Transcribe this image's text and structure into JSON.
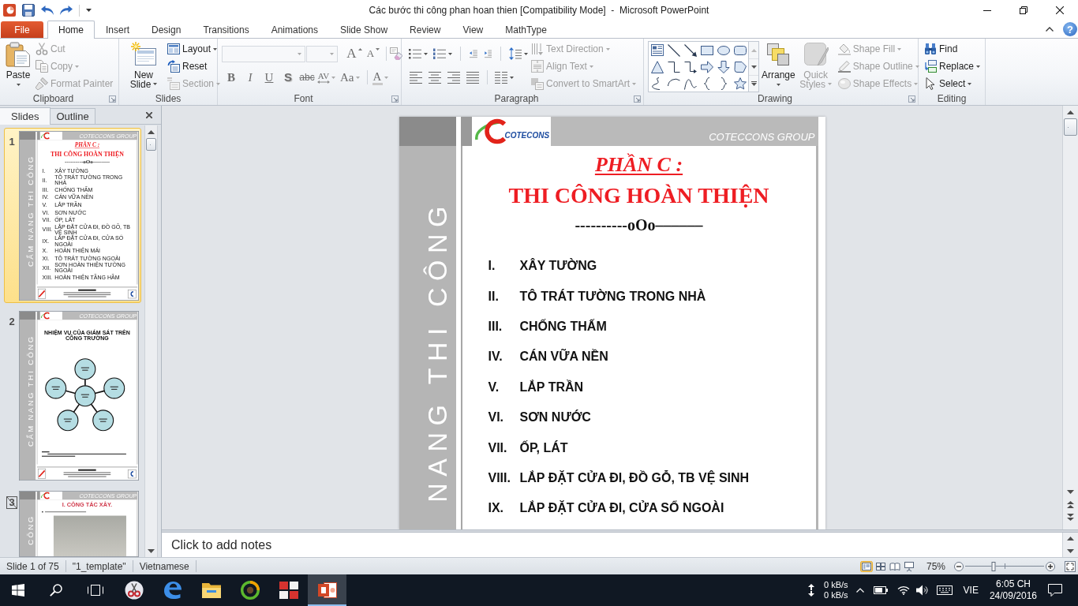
{
  "window": {
    "title": "Các bước thi công phan hoan thien [Compatibility Mode]  -  Microsoft PowerPoint"
  },
  "ribbon_tabs": [
    {
      "label": "File",
      "kind": "backstage",
      "selected": false
    },
    {
      "label": "Home",
      "kind": "tab",
      "selected": true
    },
    {
      "label": "Insert",
      "kind": "tab",
      "selected": false
    },
    {
      "label": "Design",
      "kind": "tab",
      "selected": false
    },
    {
      "label": "Transitions",
      "kind": "tab",
      "selected": false
    },
    {
      "label": "Animations",
      "kind": "tab",
      "selected": false
    },
    {
      "label": "Slide Show",
      "kind": "tab",
      "selected": false
    },
    {
      "label": "Review",
      "kind": "tab",
      "selected": false
    },
    {
      "label": "View",
      "kind": "tab",
      "selected": false
    },
    {
      "label": "MathType",
      "kind": "tab",
      "selected": false
    }
  ],
  "help": "?",
  "ribbon_groups": [
    {
      "kind": "clipboard",
      "label": "Clipboard",
      "launcher": true,
      "buttons": [
        {
          "label": "Paste",
          "dropdown": true,
          "disabled": false
        },
        {
          "label": "Cut",
          "dropdown": false,
          "disabled": true
        },
        {
          "label": "Copy",
          "dropdown": true,
          "disabled": true
        },
        {
          "label": "Format Painter",
          "dropdown": false,
          "disabled": true
        }
      ]
    },
    {
      "kind": "slides",
      "label": "Slides",
      "launcher": false,
      "buttons": [
        {
          "label": "New Slide",
          "dropdown": true,
          "disabled": false
        },
        {
          "label": "Layout",
          "dropdown": true,
          "disabled": false
        },
        {
          "label": "Reset",
          "dropdown": false,
          "disabled": false
        },
        {
          "label": "Section",
          "dropdown": true,
          "disabled": true
        }
      ]
    },
    {
      "kind": "font",
      "label": "Font",
      "launcher": true,
      "fields": [
        {
          "disabled": true
        },
        {
          "disabled": true
        }
      ],
      "tools_top": [
        {
          "glyph": "A",
          "kind": "grow",
          "dropdown": false,
          "disabled": true
        },
        {
          "glyph": "A",
          "kind": "shrink",
          "dropdown": false,
          "disabled": true
        }
      ],
      "tools_bottom": [
        {
          "glyph": "B",
          "kind": "bold",
          "dropdown": false,
          "disabled": true
        },
        {
          "glyph": "I",
          "kind": "italic",
          "dropdown": false,
          "disabled": true
        },
        {
          "glyph": "U",
          "kind": "underline",
          "dropdown": false,
          "disabled": true
        },
        {
          "glyph": "S",
          "kind": "shadow",
          "dropdown": false,
          "disabled": true
        },
        {
          "glyph": "abc",
          "kind": "strikethrough",
          "dropdown": false,
          "disabled": true
        },
        {
          "glyph": "AV",
          "kind": "spacing",
          "dropdown": true,
          "disabled": true
        },
        {
          "glyph": "Aa",
          "kind": "case",
          "dropdown": true,
          "disabled": true
        },
        {
          "glyph": "A",
          "kind": "color",
          "dropdown": true,
          "disabled": true
        }
      ]
    },
    {
      "kind": "paragraph",
      "label": "Paragraph",
      "launcher": true,
      "buttons": [
        {
          "label": "Text Direction",
          "dropdown": true,
          "disabled": true
        },
        {
          "label": "Align Text",
          "dropdown": true,
          "disabled": true
        },
        {
          "label": "Convert to SmartArt",
          "dropdown": true,
          "disabled": true
        }
      ]
    },
    {
      "kind": "drawing",
      "label": "Drawing",
      "launcher": true,
      "buttons": [
        {
          "label": "Arrange",
          "dropdown": true,
          "disabled": false
        },
        {
          "label": "Quick Styles",
          "dropdown": true,
          "disabled": true
        },
        {
          "label": "Shape Fill",
          "dropdown": true,
          "disabled": true
        },
        {
          "label": "Shape Outline",
          "dropdown": true,
          "disabled": true
        },
        {
          "label": "Shape Effects",
          "dropdown": true,
          "disabled": true
        }
      ]
    },
    {
      "kind": "editing",
      "label": "Editing",
      "launcher": false,
      "buttons": [
        {
          "label": "Find",
          "dropdown": false,
          "disabled": false
        },
        {
          "label": "Replace",
          "dropdown": true,
          "disabled": false
        },
        {
          "label": "Select",
          "dropdown": true,
          "disabled": false
        }
      ]
    }
  ],
  "pane_tabs": [
    {
      "label": "Slides",
      "selected": true
    },
    {
      "label": "Outline",
      "selected": false
    }
  ],
  "thumbnails": [
    {
      "number": "1",
      "selected": true,
      "hidden": false,
      "kind": "outline",
      "side_text": "CẨM NANG THI CÔNG",
      "header_text": "COTECCONS GROUP",
      "heading": "PHẦN C :",
      "title": "THI CÔNG HOÀN THIỆN",
      "divider": "----------oOo––––––",
      "items": [
        {
          "numeral": "I.",
          "text": "XÂY TƯỜNG"
        },
        {
          "numeral": "II.",
          "text": "TÔ TRÁT TƯỜNG TRONG NHÀ"
        },
        {
          "numeral": "III.",
          "text": "CHỐNG THẤM"
        },
        {
          "numeral": "IV.",
          "text": "CÁN VỮA NỀN"
        },
        {
          "numeral": "V.",
          "text": "LẮP TRẦN"
        },
        {
          "numeral": "VI.",
          "text": "SƠN NƯỚC"
        },
        {
          "numeral": "VII.",
          "text": "ỐP, LÁT"
        },
        {
          "numeral": "VIII.",
          "text": "LẮP ĐẶT CỬA ĐI, ĐỒ GỖ, TB VỆ SINH"
        },
        {
          "numeral": "IX.",
          "text": "LẮP ĐẶT CỬA ĐI, CỬA SỔ NGOÀI"
        },
        {
          "numeral": "X.",
          "text": "HOÀN THIỆN MÁI"
        },
        {
          "numeral": "XI.",
          "text": "TÔ TRÁT TƯỜNG NGOÀI"
        },
        {
          "numeral": "XII.",
          "text": "SƠN HOÀN THIỆN TƯỜNG NGOÀI"
        },
        {
          "numeral": "XIII.",
          "text": "HOÀN THIỆN TẦNG HẦM"
        }
      ]
    },
    {
      "number": "2",
      "selected": false,
      "hidden": false,
      "kind": "diagram",
      "side_text": "CẨM NANG THI CÔNG",
      "header_text": "COTECCONS GROUP",
      "title": "NHIỆM VỤ CỦA GIÁM SÁT TRÊN CÔNG TRƯỜNG"
    },
    {
      "number": "3",
      "selected": false,
      "hidden": true,
      "kind": "photo",
      "side_text": "CÔNG",
      "header_text": "COTECCONS GROUP",
      "title": "I. CÔNG TÁC XÂY."
    }
  ],
  "slide": {
    "kind": "outline",
    "side_text": "NANG THI CÔNG",
    "header_text": "COTECCONS GROUP",
    "logo_text": "COTECONS",
    "heading": "PHẦN C :",
    "title": "THI CÔNG HOÀN THIỆN",
    "divider": "----------oOo––––––",
    "items": [
      {
        "numeral": "I.",
        "text": "XÂY TƯỜNG"
      },
      {
        "numeral": "II.",
        "text": "TÔ TRÁT TƯỜNG TRONG NHÀ"
      },
      {
        "numeral": "III.",
        "text": "CHỐNG THẤM"
      },
      {
        "numeral": "IV.",
        "text": "CÁN VỮA NỀN"
      },
      {
        "numeral": "V.",
        "text": "LẮP TRẦN"
      },
      {
        "numeral": "VI.",
        "text": "SƠN NƯỚC"
      },
      {
        "numeral": "VII.",
        "text": "ỐP, LÁT"
      },
      {
        "numeral": "VIII.",
        "text": "LẮP ĐẶT CỬA ĐI, ĐỒ GỖ, TB VỆ SINH"
      },
      {
        "numeral": "IX.",
        "text": "LẮP ĐẶT CỬA ĐI, CỬA SỔ NGOÀI"
      }
    ]
  },
  "notes": {
    "placeholder": "Click to add notes"
  },
  "status_bar": {
    "items": [
      "Slide 1 of 75",
      "\"1_template\"",
      "Vietnamese"
    ],
    "views": [
      {
        "selected": true
      },
      {
        "selected": false
      },
      {
        "selected": false
      },
      {
        "selected": false
      }
    ],
    "zoom": "75%",
    "zoom_slider": {
      "level": 0.36
    }
  },
  "taskbar": {
    "apps": [
      {
        "selected": false
      },
      {
        "selected": false
      },
      {
        "selected": false
      },
      {
        "selected": false
      },
      {
        "selected": false
      },
      {
        "selected": true
      }
    ],
    "network": [
      "0 kB/s",
      "0 kB/s"
    ],
    "language": "VIE",
    "time": "6:05 CH",
    "date": "24/09/2016"
  }
}
